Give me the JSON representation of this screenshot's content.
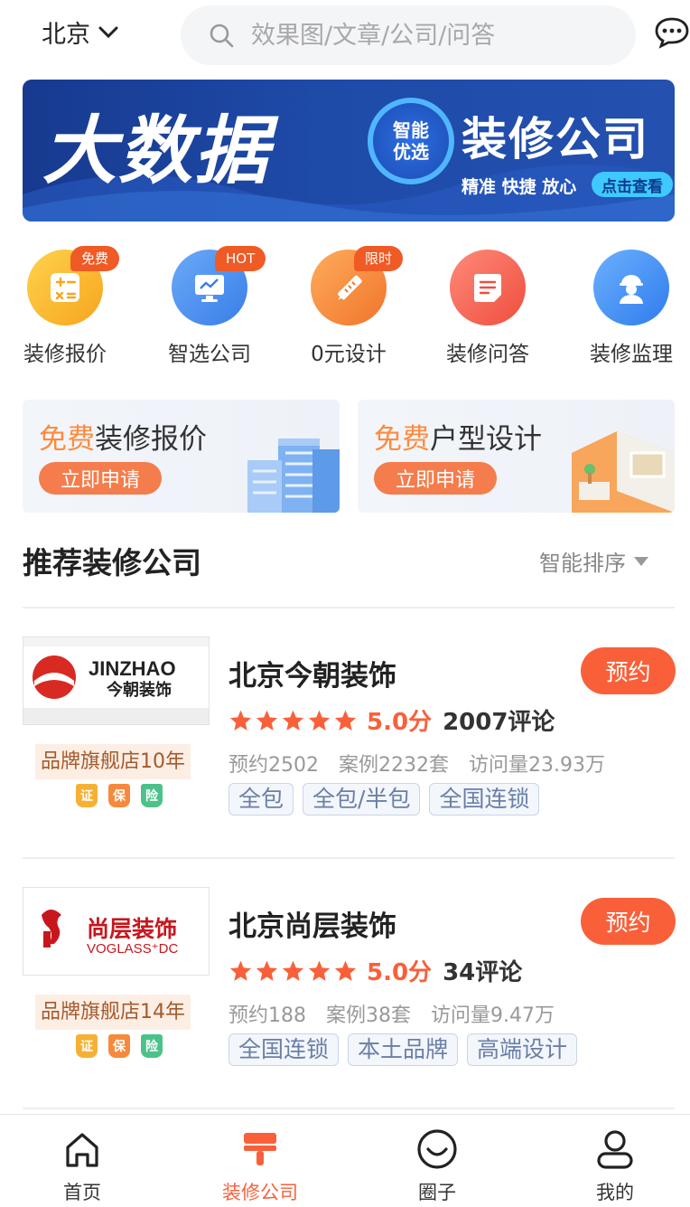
{
  "header": {
    "city": "北京",
    "search_placeholder": "效果图/文章/公司/问答"
  },
  "banner": {
    "main_text": "大数据",
    "circle_line1": "智能",
    "circle_line2": "优选",
    "title": "装修公司",
    "slogan": "精准 快捷 放心",
    "button": "点击查看"
  },
  "quick_nav": [
    {
      "label": "装修报价",
      "badge": "免费",
      "icon": "calculator-icon",
      "color": "#f8b92b"
    },
    {
      "label": "智选公司",
      "badge": "HOT",
      "icon": "monitor-icon",
      "color": "#4c8ff0"
    },
    {
      "label": "0元设计",
      "badge": "限时",
      "icon": "pencil-ruler-icon",
      "color": "#f58b3a"
    },
    {
      "label": "装修问答",
      "badge": "",
      "icon": "document-icon",
      "color": "#f2614f"
    },
    {
      "label": "装修监理",
      "badge": "",
      "icon": "worker-icon",
      "color": "#3f8cf0"
    }
  ],
  "promos": [
    {
      "highlight": "免费",
      "title": "装修报价",
      "button": "立即申请"
    },
    {
      "highlight": "免费",
      "title": "户型设计",
      "button": "立即申请"
    }
  ],
  "section": {
    "title": "推荐装修公司",
    "sort_label": "智能排序"
  },
  "companies": [
    {
      "name": "北京今朝装饰",
      "logo_en": "JINZHAO",
      "logo_cn": "今朝装饰",
      "brand_badge": "品牌旗舰店10年",
      "guarantees": [
        "证",
        "保",
        "险"
      ],
      "score": "5.0分",
      "reviews": "2007评论",
      "stats": [
        "预约2502",
        "案例2232套",
        "访问量23.93万"
      ],
      "tags": [
        "全包",
        "全包/半包",
        "全国连锁"
      ],
      "book_label": "预约"
    },
    {
      "name": "北京尚层装饰",
      "logo_en": "VOGLASS⁺DC",
      "logo_cn": "尚层装饰",
      "brand_badge": "品牌旗舰店14年",
      "guarantees": [
        "证",
        "保",
        "险"
      ],
      "score": "5.0分",
      "reviews": "34评论",
      "stats": [
        "预约188",
        "案例38套",
        "访问量9.47万"
      ],
      "tags": [
        "全国连锁",
        "本土品牌",
        "高端设计"
      ],
      "book_label": "预约"
    }
  ],
  "tabbar": [
    {
      "label": "首页",
      "icon": "home-icon",
      "active": false
    },
    {
      "label": "装修公司",
      "icon": "paint-roller-icon",
      "active": true
    },
    {
      "label": "圈子",
      "icon": "smile-icon",
      "active": false
    },
    {
      "label": "我的",
      "icon": "user-icon",
      "active": false
    }
  ],
  "colors": {
    "accent": "#f9603a",
    "banner_blue": "#1e4aa8",
    "tag_text": "#6a7fa8"
  }
}
